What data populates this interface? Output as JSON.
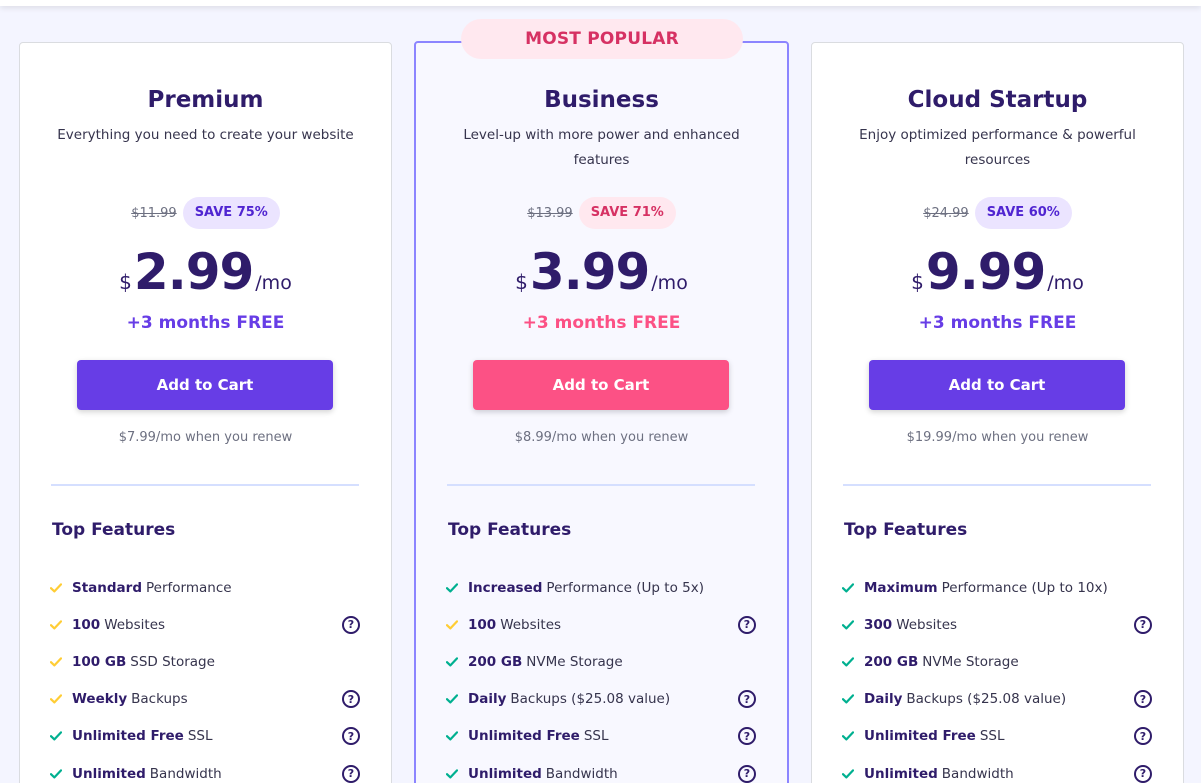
{
  "popular_badge": "MOST POPULAR",
  "colors": {
    "purple": "#673de6",
    "pink": "#fc5185",
    "navy": "#2f1c6a",
    "check_yellow": "#ffcd35",
    "check_green": "#00b090"
  },
  "plans": [
    {
      "name": "Premium",
      "description": "Everything you need to create your website",
      "old_price": "$11.99",
      "save": "SAVE 75%",
      "currency": "$",
      "price": "2.99",
      "per": "/mo",
      "free": "+3 months FREE",
      "button": "Add to Cart",
      "renew": "$7.99/mo when you renew",
      "features_title": "Top Features",
      "features": [
        {
          "bold": "Standard",
          "text": "Performance",
          "check": "yellow",
          "help": false
        },
        {
          "bold": "100",
          "text": "Websites",
          "check": "yellow",
          "help": true
        },
        {
          "bold": "100 GB",
          "text": "SSD Storage",
          "check": "yellow",
          "help": false
        },
        {
          "bold": "Weekly",
          "text": "Backups",
          "check": "yellow",
          "help": true
        },
        {
          "bold": "Unlimited Free",
          "text": "SSL",
          "check": "green",
          "help": true
        },
        {
          "bold": "Unlimited",
          "text": "Bandwidth",
          "check": "green",
          "help": true
        }
      ]
    },
    {
      "name": "Business",
      "description": "Level-up with more power and enhanced features",
      "old_price": "$13.99",
      "save": "SAVE 71%",
      "currency": "$",
      "price": "3.99",
      "per": "/mo",
      "free": "+3 months FREE",
      "button": "Add to Cart",
      "renew": "$8.99/mo when you renew",
      "features_title": "Top Features",
      "features": [
        {
          "bold": "Increased",
          "text": "Performance (Up to 5x)",
          "check": "green",
          "help": false
        },
        {
          "bold": "100",
          "text": "Websites",
          "check": "yellow",
          "help": true
        },
        {
          "bold": "200 GB",
          "text": "NVMe Storage",
          "check": "green",
          "help": false
        },
        {
          "bold": "Daily",
          "text": "Backups ($25.08 value)",
          "check": "green",
          "help": true
        },
        {
          "bold": "Unlimited Free",
          "text": "SSL",
          "check": "green",
          "help": true
        },
        {
          "bold": "Unlimited",
          "text": "Bandwidth",
          "check": "green",
          "help": true
        }
      ]
    },
    {
      "name": "Cloud Startup",
      "description": "Enjoy optimized performance & powerful resources",
      "old_price": "$24.99",
      "save": "SAVE 60%",
      "currency": "$",
      "price": "9.99",
      "per": "/mo",
      "free": "+3 months FREE",
      "button": "Add to Cart",
      "renew": "$19.99/mo when you renew",
      "features_title": "Top Features",
      "features": [
        {
          "bold": "Maximum",
          "text": "Performance (Up to 10x)",
          "check": "green",
          "help": false
        },
        {
          "bold": "300",
          "text": "Websites",
          "check": "green",
          "help": true
        },
        {
          "bold": "200 GB",
          "text": "NVMe Storage",
          "check": "green",
          "help": false
        },
        {
          "bold": "Daily",
          "text": "Backups ($25.08 value)",
          "check": "green",
          "help": true
        },
        {
          "bold": "Unlimited Free",
          "text": "SSL",
          "check": "green",
          "help": true
        },
        {
          "bold": "Unlimited",
          "text": "Bandwidth",
          "check": "green",
          "help": true
        }
      ]
    }
  ]
}
